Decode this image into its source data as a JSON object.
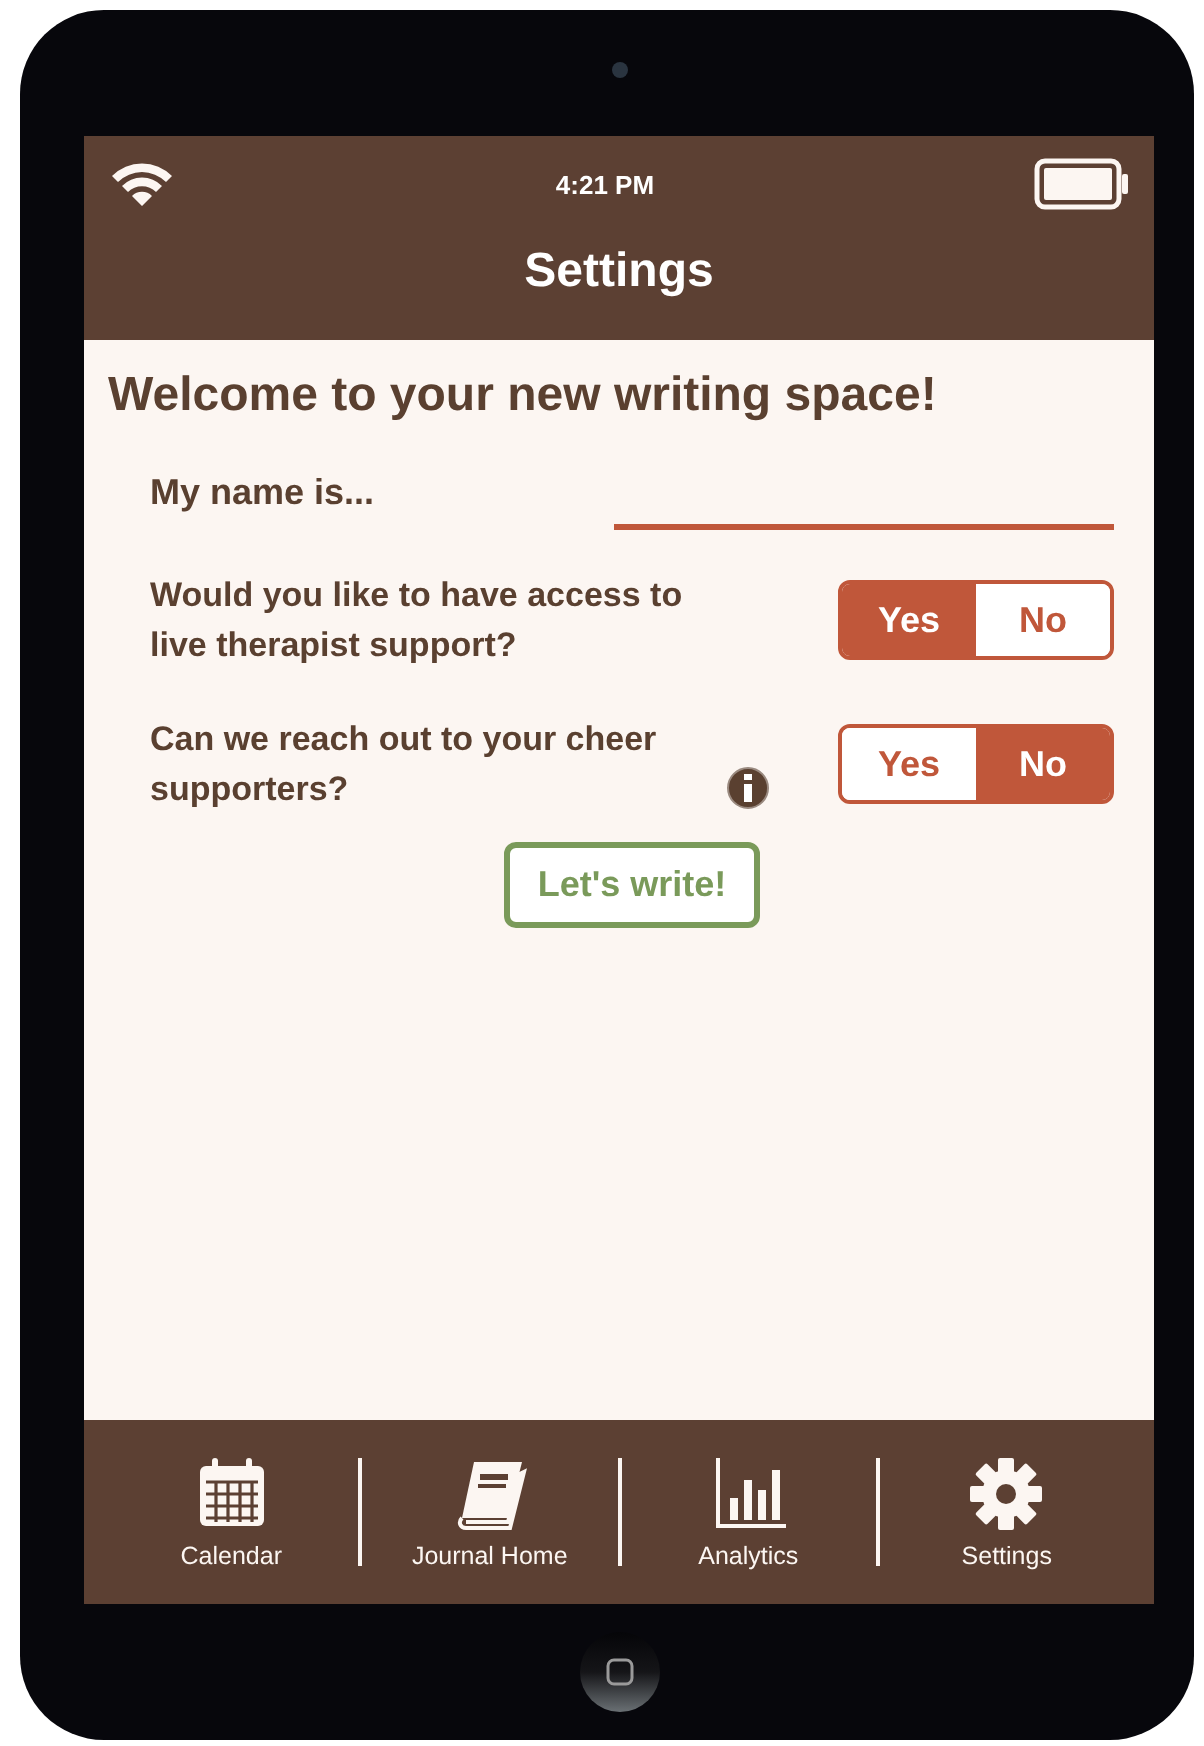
{
  "status_bar": {
    "time": "4:21 PM"
  },
  "title": "Settings",
  "heading": "Welcome to your new writing space!",
  "name_field": {
    "label": "My name is..."
  },
  "questions": [
    {
      "text": "Would you like to have access to live therapist support?",
      "info": false,
      "options": [
        {
          "label": "Yes",
          "selected": true
        },
        {
          "label": "No",
          "selected": false
        }
      ]
    },
    {
      "text": "Can we reach out to your cheer supporters?",
      "info": true,
      "options": [
        {
          "label": "Yes",
          "selected": false
        },
        {
          "label": "No",
          "selected": true
        }
      ]
    }
  ],
  "button": "Let's write!",
  "tabs": [
    {
      "label": "Calendar",
      "kind": "calendar"
    },
    {
      "label": "Journal Home",
      "kind": "book"
    },
    {
      "label": "Analytics",
      "kind": "chart"
    },
    {
      "label": "Settings",
      "kind": "gear"
    }
  ]
}
